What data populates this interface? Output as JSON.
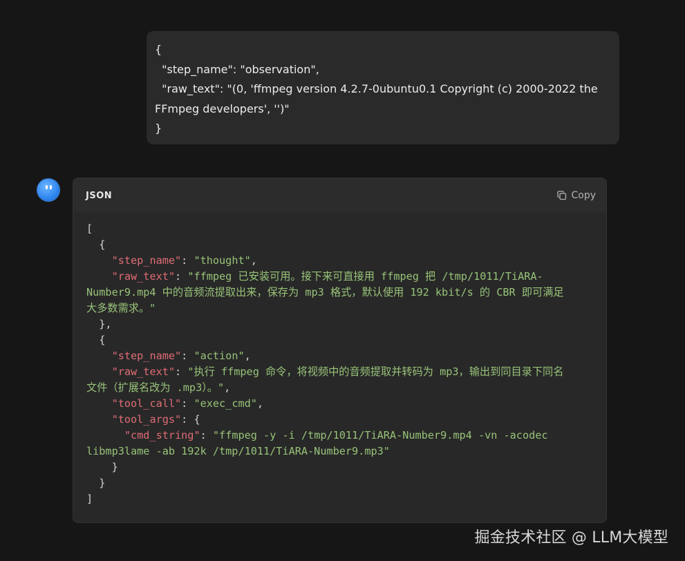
{
  "user_message": {
    "lines": [
      "{",
      "  \"step_name\": \"observation\",",
      "  \"raw_text\": \"(0, 'ffmpeg version 4.2.7-0ubuntu0.1 Copyright (c) 2000-2022 the",
      "FFmpeg developers', '')\"",
      "}"
    ]
  },
  "assistant": {
    "avatar_icon": "bot-face-icon",
    "code_block": {
      "language": "JSON",
      "copy_label": "Copy",
      "copy_icon": "copy-icon",
      "lines": [
        [
          {
            "t": "p",
            "v": "["
          }
        ],
        [
          {
            "t": "p",
            "v": "  {"
          }
        ],
        [
          {
            "t": "p",
            "v": "    "
          },
          {
            "t": "k",
            "v": "\"step_name\""
          },
          {
            "t": "p",
            "v": ": "
          },
          {
            "t": "s",
            "v": "\"thought\""
          },
          {
            "t": "p",
            "v": ","
          }
        ],
        [
          {
            "t": "p",
            "v": "    "
          },
          {
            "t": "k",
            "v": "\"raw_text\""
          },
          {
            "t": "p",
            "v": ": "
          },
          {
            "t": "s",
            "v": "\"ffmpeg 已安装可用。接下来可直接用 ffmpeg 把 /tmp/1011/TiARA-"
          }
        ],
        [
          {
            "t": "s",
            "v": "Number9.mp4 中的音频流提取出来，保存为 mp3 格式，默认使用 192 kbit/s 的 CBR 即可满足"
          }
        ],
        [
          {
            "t": "s",
            "v": "大多数需求。\""
          }
        ],
        [
          {
            "t": "p",
            "v": "  },"
          }
        ],
        [
          {
            "t": "p",
            "v": "  {"
          }
        ],
        [
          {
            "t": "p",
            "v": "    "
          },
          {
            "t": "k",
            "v": "\"step_name\""
          },
          {
            "t": "p",
            "v": ": "
          },
          {
            "t": "s",
            "v": "\"action\""
          },
          {
            "t": "p",
            "v": ","
          }
        ],
        [
          {
            "t": "p",
            "v": "    "
          },
          {
            "t": "k",
            "v": "\"raw_text\""
          },
          {
            "t": "p",
            "v": ": "
          },
          {
            "t": "s",
            "v": "\"执行 ffmpeg 命令，将视频中的音频提取并转码为 mp3，输出到同目录下同名"
          }
        ],
        [
          {
            "t": "s",
            "v": "文件（扩展名改为 .mp3）。\""
          },
          {
            "t": "p",
            "v": ","
          }
        ],
        [
          {
            "t": "p",
            "v": "    "
          },
          {
            "t": "k",
            "v": "\"tool_call\""
          },
          {
            "t": "p",
            "v": ": "
          },
          {
            "t": "s",
            "v": "\"exec_cmd\""
          },
          {
            "t": "p",
            "v": ","
          }
        ],
        [
          {
            "t": "p",
            "v": "    "
          },
          {
            "t": "k",
            "v": "\"tool_args\""
          },
          {
            "t": "p",
            "v": ": {"
          }
        ],
        [
          {
            "t": "p",
            "v": "      "
          },
          {
            "t": "k",
            "v": "\"cmd_string\""
          },
          {
            "t": "p",
            "v": ": "
          },
          {
            "t": "s",
            "v": "\"ffmpeg -y -i /tmp/1011/TiARA-Number9.mp4 -vn -acodec"
          }
        ],
        [
          {
            "t": "s",
            "v": "libmp3lame -ab 192k /tmp/1011/TiARA-Number9.mp3\""
          }
        ],
        [
          {
            "t": "p",
            "v": "    }"
          }
        ],
        [
          {
            "t": "p",
            "v": "  }"
          }
        ],
        [
          {
            "t": "p",
            "v": "]"
          }
        ]
      ]
    }
  },
  "watermark": "掘金技术社区 @ LLM大模型",
  "colors": {
    "background": "#161616",
    "bubble": "#2a2a2a",
    "code_bg": "#282828",
    "key": "#e06c75",
    "string": "#98c379",
    "avatar": "#2f86f0"
  }
}
